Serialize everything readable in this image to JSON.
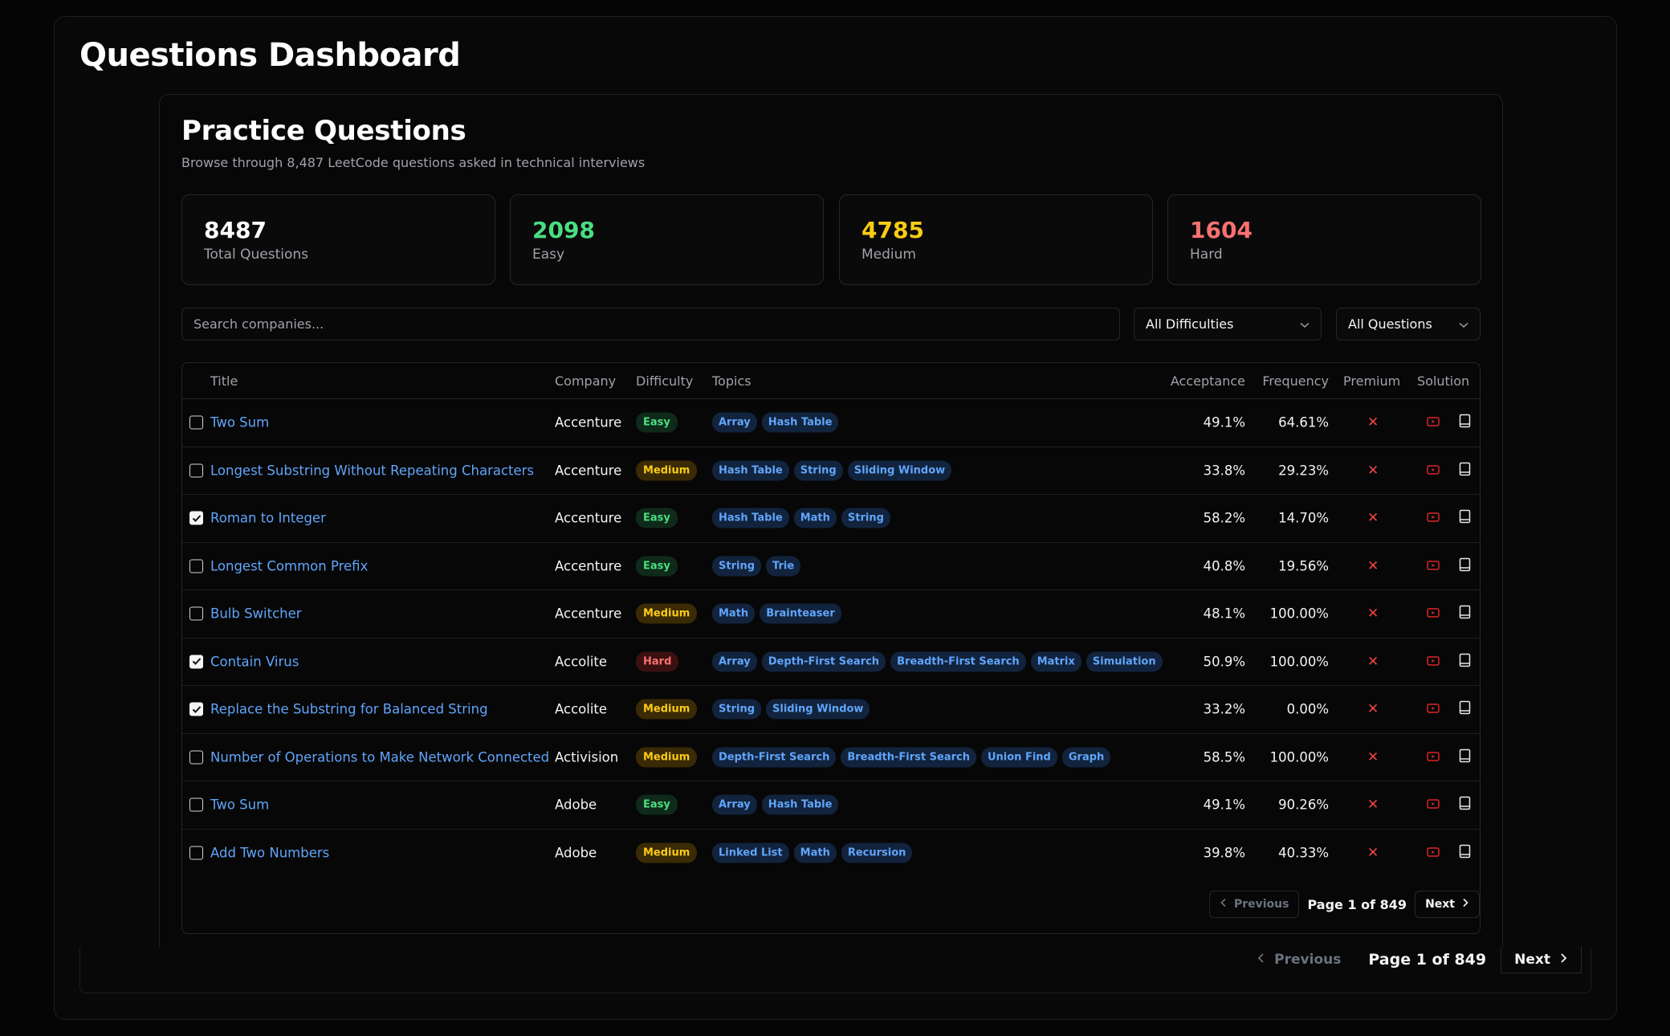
{
  "dashboard_title": "Questions Dashboard",
  "practice": {
    "title": "Practice Questions",
    "subtitle": "Browse through 8,487 LeetCode questions asked in technical interviews"
  },
  "stats": [
    {
      "value": "8487",
      "label": "Total Questions",
      "color": "#ffffff"
    },
    {
      "value": "2098",
      "label": "Easy",
      "color": "#4ade80"
    },
    {
      "value": "4785",
      "label": "Medium",
      "color": "#facc15"
    },
    {
      "value": "1604",
      "label": "Hard",
      "color": "#f87171"
    }
  ],
  "search": {
    "placeholder": "Search companies..."
  },
  "filters": {
    "difficulty": "All Difficulties",
    "questions": "All Questions"
  },
  "columns": {
    "title": "Title",
    "company": "Company",
    "difficulty": "Difficulty",
    "topics": "Topics",
    "acceptance": "Acceptance",
    "frequency": "Frequency",
    "premium": "Premium",
    "solution": "Solution"
  },
  "rows": [
    {
      "checked": false,
      "title": "Two Sum",
      "company": "Accenture",
      "difficulty": "Easy",
      "topics": [
        "Array",
        "Hash Table"
      ],
      "acceptance": "49.1%",
      "frequency": "64.61%"
    },
    {
      "checked": false,
      "title": "Longest Substring Without Repeating Characters",
      "company": "Accenture",
      "difficulty": "Medium",
      "topics": [
        "Hash Table",
        "String",
        "Sliding Window"
      ],
      "acceptance": "33.8%",
      "frequency": "29.23%"
    },
    {
      "checked": true,
      "title": "Roman to Integer",
      "company": "Accenture",
      "difficulty": "Easy",
      "topics": [
        "Hash Table",
        "Math",
        "String"
      ],
      "acceptance": "58.2%",
      "frequency": "14.70%"
    },
    {
      "checked": false,
      "title": "Longest Common Prefix",
      "company": "Accenture",
      "difficulty": "Easy",
      "topics": [
        "String",
        "Trie"
      ],
      "acceptance": "40.8%",
      "frequency": "19.56%"
    },
    {
      "checked": false,
      "title": "Bulb Switcher",
      "company": "Accenture",
      "difficulty": "Medium",
      "topics": [
        "Math",
        "Brainteaser"
      ],
      "acceptance": "48.1%",
      "frequency": "100.00%"
    },
    {
      "checked": true,
      "title": "Contain Virus",
      "company": "Accolite",
      "difficulty": "Hard",
      "topics": [
        "Array",
        "Depth-First Search",
        "Breadth-First Search",
        "Matrix",
        "Simulation"
      ],
      "acceptance": "50.9%",
      "frequency": "100.00%"
    },
    {
      "checked": true,
      "title": "Replace the Substring for Balanced String",
      "company": "Accolite",
      "difficulty": "Medium",
      "topics": [
        "String",
        "Sliding Window"
      ],
      "acceptance": "33.2%",
      "frequency": "0.00%"
    },
    {
      "checked": false,
      "title": "Number of Operations to Make Network Connected",
      "company": "Activision",
      "difficulty": "Medium",
      "topics": [
        "Depth-First Search",
        "Breadth-First Search",
        "Union Find",
        "Graph"
      ],
      "acceptance": "58.5%",
      "frequency": "100.00%"
    },
    {
      "checked": false,
      "title": "Two Sum",
      "company": "Adobe",
      "difficulty": "Easy",
      "topics": [
        "Array",
        "Hash Table"
      ],
      "acceptance": "49.1%",
      "frequency": "90.26%"
    },
    {
      "checked": false,
      "title": "Add Two Numbers",
      "company": "Adobe",
      "difficulty": "Medium",
      "topics": [
        "Linked List",
        "Math",
        "Recursion"
      ],
      "acceptance": "39.8%",
      "frequency": "40.33%"
    }
  ],
  "pagination": {
    "previous": "Previous",
    "page_info": "Page 1 of 849",
    "next": "Next"
  },
  "colors": {
    "link": "#60a5fa",
    "premium_x": "#ef4444",
    "video_icon": "#dc2626"
  }
}
